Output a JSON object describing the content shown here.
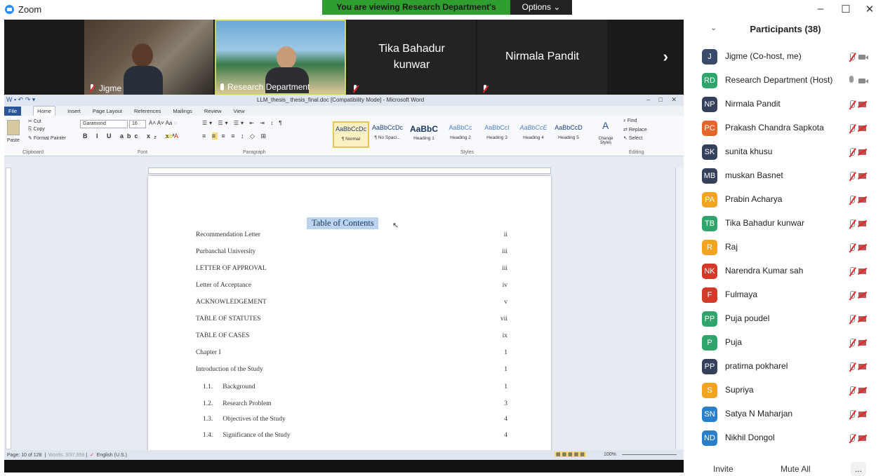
{
  "app": {
    "title": "Zoom"
  },
  "banner": {
    "text": "You are viewing Research Department's screen",
    "options_label": "Options"
  },
  "video": {
    "tiles": [
      {
        "name": "Jigme"
      },
      {
        "name": "Research Department"
      },
      {
        "name": "Tika Bahadur\nkunwar"
      },
      {
        "name": "Nirmala Pandit"
      }
    ]
  },
  "word": {
    "title": "LLM_thesis_ thesis_final.doc [Compatibility Mode] - Microsoft Word",
    "tabs": [
      "File",
      "Home",
      "Insert",
      "Page Layout",
      "References",
      "Mailings",
      "Review",
      "View"
    ],
    "clipboard": {
      "paste": "Paste",
      "cut": "Cut",
      "copy": "Copy",
      "format_painter": "Format Painter",
      "label": "Clipboard"
    },
    "font": {
      "name": "Garamond",
      "size": "16",
      "label": "Font"
    },
    "paragraph_label": "Paragraph",
    "styles": [
      {
        "sample": "AaBbCcDc",
        "name": "¶ Normal"
      },
      {
        "sample": "AaBbCcDc",
        "name": "¶ No Spaci..."
      },
      {
        "sample": "AaBbC",
        "name": "Heading 1"
      },
      {
        "sample": "AaBbCc",
        "name": "Heading 2"
      },
      {
        "sample": "AaBbCcI",
        "name": "Heading 3"
      },
      {
        "sample": "AaBbCcE",
        "name": "Heading 4"
      },
      {
        "sample": "AaBbCcD",
        "name": "Heading 5"
      }
    ],
    "styles_label": "Styles",
    "change_styles": "Change Styles",
    "editing": {
      "find": "Find",
      "replace": "Replace",
      "select": "Select",
      "label": "Editing"
    },
    "toc_title": "Table of Contents",
    "toc": [
      {
        "label": "Recommendation Letter",
        "page": "ii"
      },
      {
        "label": "Purbanchal University",
        "page": "iii"
      },
      {
        "label": "LETTER OF APPROVAL",
        "page": "iii"
      },
      {
        "label": "Letter of Acceptance",
        "page": "iv"
      },
      {
        "label": "ACKNOWLEDGEMENT",
        "page": "v"
      },
      {
        "label": "TABLE OF STATUTES",
        "page": "vii"
      },
      {
        "label": "TABLE OF CASES",
        "page": "ix"
      },
      {
        "label": "Chapter I",
        "page": "1"
      },
      {
        "label": "Introduction of the Study",
        "page": "1"
      }
    ],
    "toc_sub": [
      {
        "num": "1.1.",
        "label": "Background",
        "page": "1"
      },
      {
        "num": "1.2.",
        "label": "Research Problem",
        "page": "3"
      },
      {
        "num": "1.3.",
        "label": "Objectives of the Study",
        "page": "4"
      },
      {
        "num": "1.4.",
        "label": "Significance of the Study",
        "page": "4"
      }
    ],
    "status": {
      "page": "Page: 10 of 128",
      "words": "Words: 3/37,959",
      "language": "English (U.S.)",
      "zoom": "100%"
    }
  },
  "participants": {
    "title": "Participants (38)",
    "list": [
      {
        "initials": "J",
        "name": "Jigme (Co-host, me)",
        "color": "#3a4a6b",
        "mic": "off",
        "cam": "on"
      },
      {
        "initials": "RD",
        "name": "Research Department (Host)",
        "color": "#2fa56b",
        "mic": "on",
        "cam": "on"
      },
      {
        "initials": "NP",
        "name": "Nirmala Pandit",
        "color": "#34405c",
        "mic": "off",
        "cam": "off"
      },
      {
        "initials": "PC",
        "name": "Prakash Chandra Sapkota",
        "color": "#e4662c",
        "mic": "off",
        "cam": "off"
      },
      {
        "initials": "SK",
        "name": "sunita khusu",
        "color": "#34405c",
        "mic": "off",
        "cam": "off"
      },
      {
        "initials": "MB",
        "name": "muskan Basnet",
        "color": "#34405c",
        "mic": "off",
        "cam": "off"
      },
      {
        "initials": "PA",
        "name": "Prabin Acharya",
        "color": "#f2a31f",
        "mic": "off",
        "cam": "off"
      },
      {
        "initials": "TB",
        "name": "Tika Bahadur kunwar",
        "color": "#2fa56b",
        "mic": "off",
        "cam": "off"
      },
      {
        "initials": "R",
        "name": "Raj",
        "color": "#f2a31f",
        "mic": "off",
        "cam": "off"
      },
      {
        "initials": "NK",
        "name": "Narendra Kumar sah",
        "color": "#d23a2a",
        "mic": "off",
        "cam": "off"
      },
      {
        "initials": "F",
        "name": "Fulmaya",
        "color": "#d23a2a",
        "mic": "off",
        "cam": "off"
      },
      {
        "initials": "PP",
        "name": "Puja poudel",
        "color": "#2fa56b",
        "mic": "off",
        "cam": "off"
      },
      {
        "initials": "P",
        "name": "Puja",
        "color": "#2fa56b",
        "mic": "off",
        "cam": "off"
      },
      {
        "initials": "PP",
        "name": "pratima pokharel",
        "color": "#34405c",
        "mic": "off",
        "cam": "off"
      },
      {
        "initials": "S",
        "name": "Supriya",
        "color": "#f2a31f",
        "mic": "off",
        "cam": "off"
      },
      {
        "initials": "SN",
        "name": "Satya N Maharjan",
        "color": "#2b7fc9",
        "mic": "off",
        "cam": "off"
      },
      {
        "initials": "ND",
        "name": "Nikhil Dongol",
        "color": "#2b7fc9",
        "mic": "off",
        "cam": "off"
      }
    ],
    "invite_label": "Invite",
    "mute_all_label": "Mute All",
    "more_label": "..."
  }
}
